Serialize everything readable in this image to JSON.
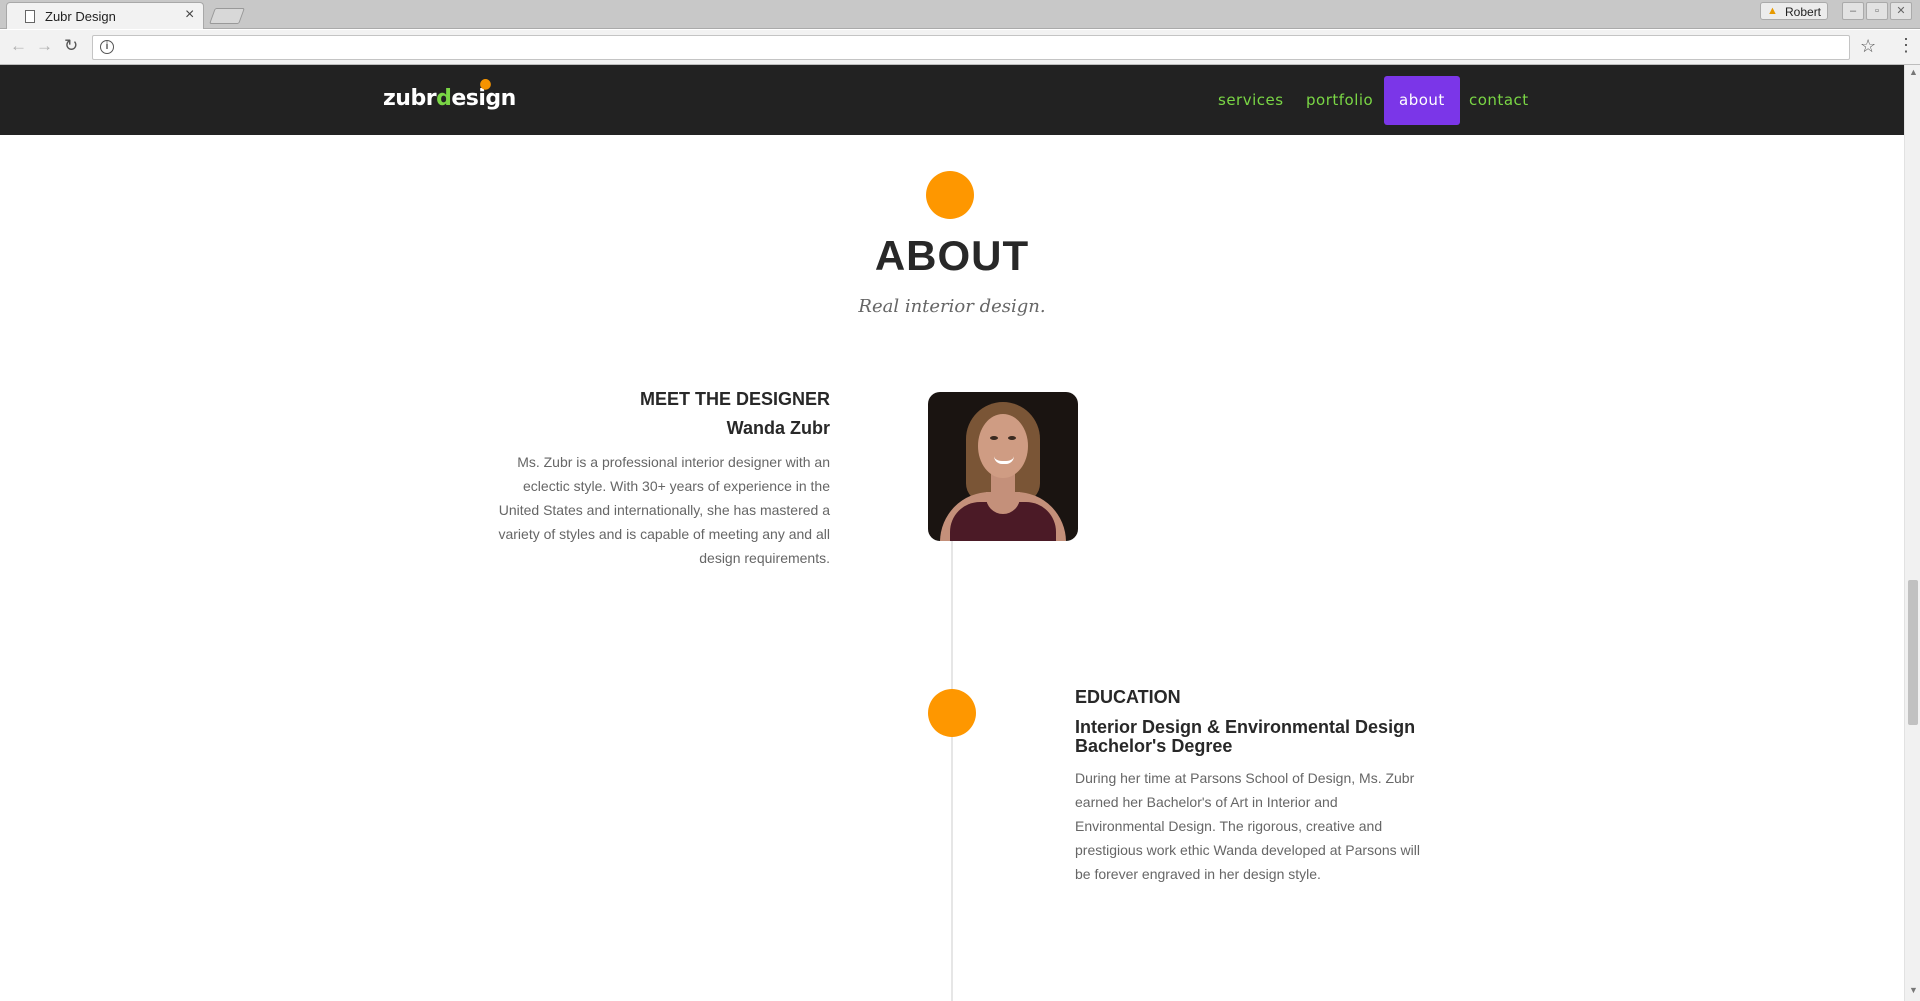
{
  "browser": {
    "tab_title": "Zubr Design",
    "tab_close": "×",
    "profile_name": "Robert",
    "url": ""
  },
  "navbar": {
    "logo_prefix": "zubr",
    "logo_accent": "d",
    "logo_mid": "es",
    "logo_dot_letter": "i",
    "logo_suffix": "gn",
    "links": [
      {
        "label": "services",
        "active": false
      },
      {
        "label": "portfolio",
        "active": false
      },
      {
        "label": "about",
        "active": true
      },
      {
        "label": "contact",
        "active": false
      }
    ]
  },
  "about": {
    "title": "ABOUT",
    "subtitle": "Real interior design."
  },
  "designer": {
    "heading": "MEET THE DESIGNER",
    "name": "Wanda Zubr",
    "text": "Ms. Zubr is a professional interior designer with an eclectic style. With 30+ years of experience in the United States and internationally, she has mastered a variety of styles and is capable of meeting any and all design requirements."
  },
  "education": {
    "heading": "EDUCATION",
    "subheading_line1": "Interior Design & Environmental Design",
    "subheading_line2": "Bachelor's Degree",
    "text": "During her time at Parsons School of Design, Ms. Zubr earned her Bachelor's of Art in Interior and Environmental Design. The rigorous, creative and prestigious work ethic Wanda developed at Parsons will be forever engraved in her design style."
  },
  "colors": {
    "navbar_bg": "#222222",
    "nav_link": "#7ad645",
    "nav_active_bg": "#7b36e8",
    "accent_orange": "#fe9700",
    "heading_text": "#282828",
    "body_text": "#666666"
  },
  "icons": {
    "tab_page": "page-icon",
    "back": "arrow-left-icon",
    "forward": "arrow-right-icon",
    "reload": "reload-icon",
    "site_info": "info-icon",
    "bookmark": "star-icon",
    "browser_menu": "kebab-menu-icon",
    "profile_warning": "warning-icon"
  }
}
